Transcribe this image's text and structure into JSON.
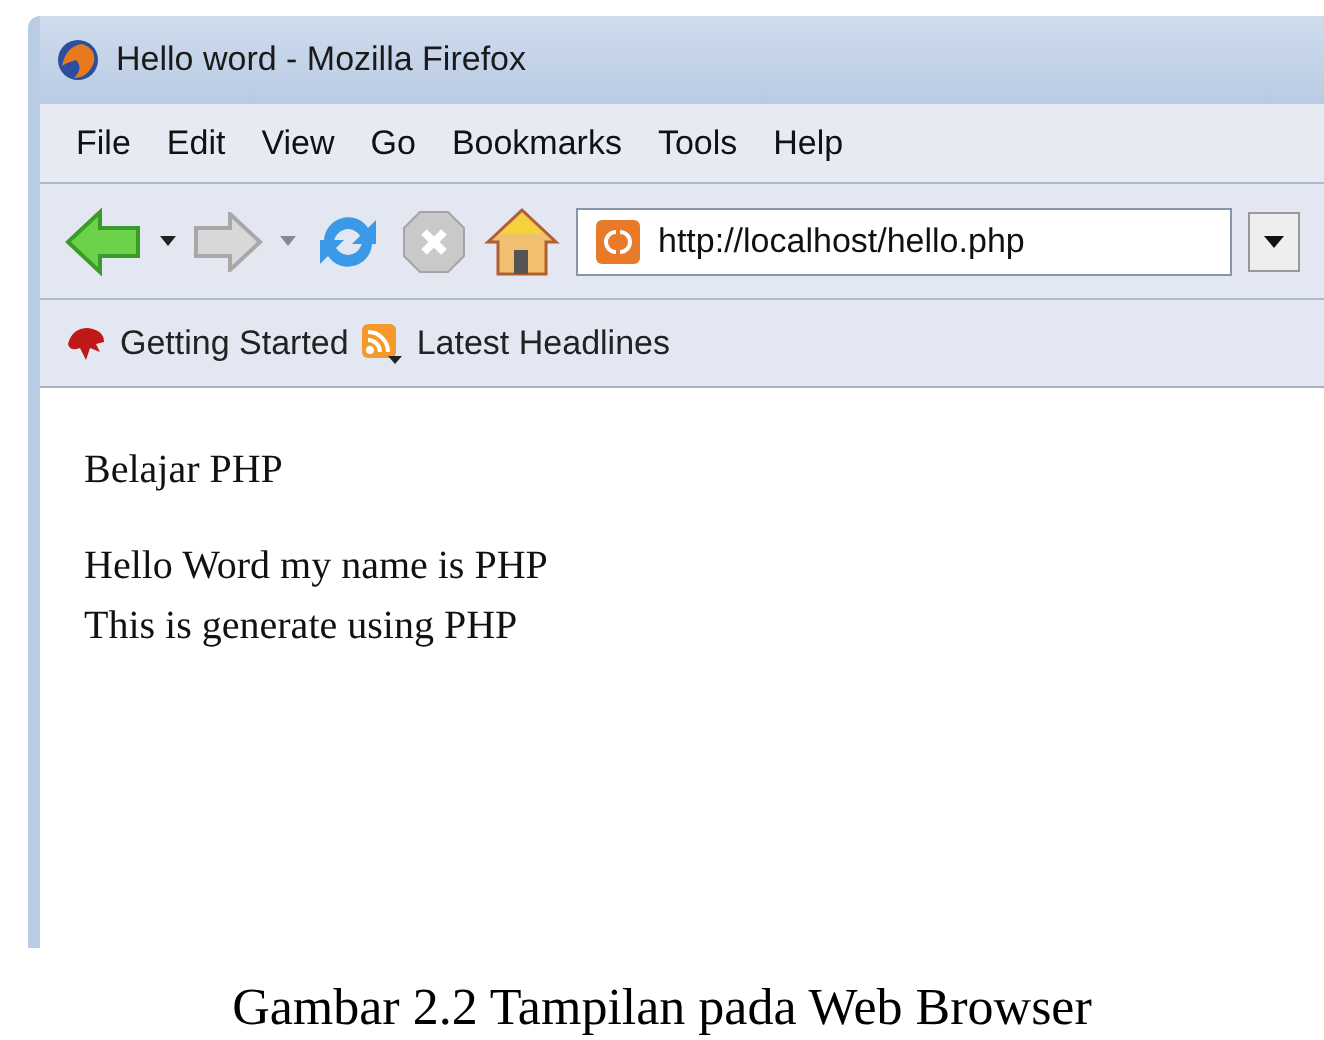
{
  "window": {
    "title": "Hello word - Mozilla Firefox"
  },
  "menu": [
    "File",
    "Edit",
    "View",
    "Go",
    "Bookmarks",
    "Tools",
    "Help"
  ],
  "address_bar": {
    "value": "http://localhost/hello.php"
  },
  "bookmarks": [
    "Getting Started",
    "Latest Headlines"
  ],
  "content": {
    "heading": "Belajar PHP",
    "lines": [
      "Hello Word my name is PHP",
      "This is generate using PHP"
    ]
  },
  "caption": "Gambar 2.2 Tampilan pada Web Browser"
}
